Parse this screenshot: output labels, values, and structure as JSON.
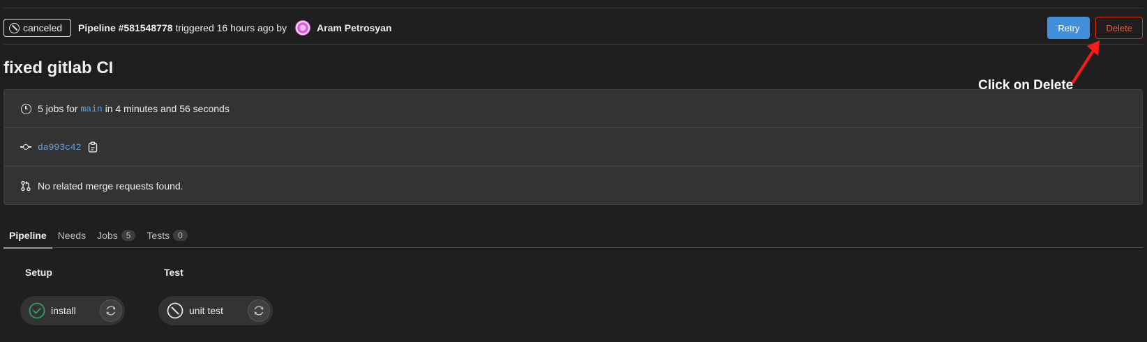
{
  "header": {
    "status": "canceled",
    "pipeline_label": "Pipeline #581548778",
    "triggered_text": "triggered 16 hours ago by",
    "author": "Aram Petrosyan",
    "retry_label": "Retry",
    "delete_label": "Delete"
  },
  "title": "fixed gitlab CI",
  "info": {
    "jobs_prefix": "5 jobs for",
    "branch": "main",
    "duration": "in 4 minutes and 56 seconds",
    "commit_sha": "da993c42",
    "merge_requests": "No related merge requests found."
  },
  "annotation": {
    "text": "Click on Delete",
    "color": "#ff1a1a"
  },
  "tabs": [
    {
      "label": "Pipeline",
      "count": null
    },
    {
      "label": "Needs",
      "count": null
    },
    {
      "label": "Jobs",
      "count": "5"
    },
    {
      "label": "Tests",
      "count": "0"
    }
  ],
  "stages": [
    {
      "title": "Setup",
      "job": {
        "name": "install",
        "status": "success",
        "status_color": "#2da160"
      }
    },
    {
      "title": "Test",
      "job": {
        "name": "unit test",
        "status": "canceled",
        "status_color": "#e6e6e6"
      }
    }
  ],
  "icons": {
    "status": "cancel-circle-icon",
    "duration": "clock-icon",
    "commit": "commit-icon",
    "copy": "clipboard-icon",
    "merge": "merge-request-icon",
    "retry": "retry-icon"
  }
}
